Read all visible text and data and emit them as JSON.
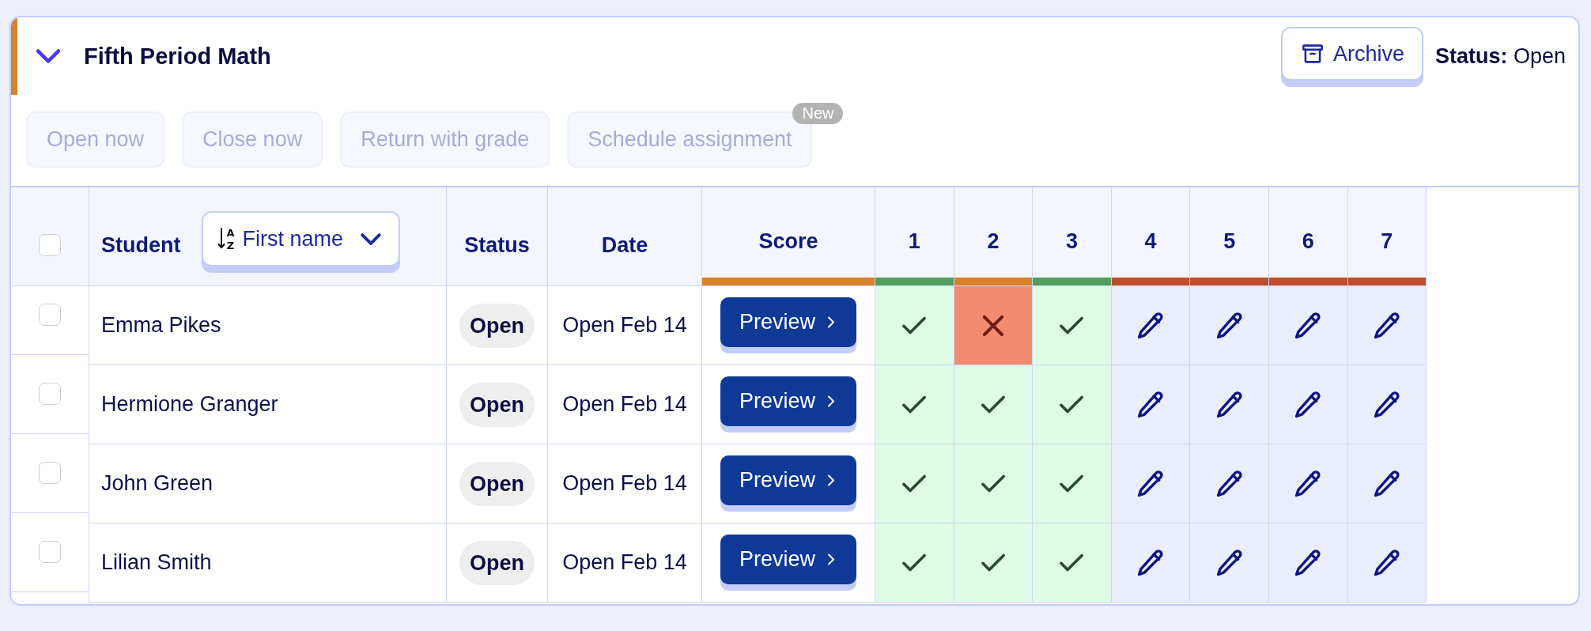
{
  "section": {
    "title": "Fifth Period Math",
    "expanded": true
  },
  "archive_button": {
    "label": "Archive"
  },
  "status": "**Status:** Open",
  "actions": [
    {
      "label": "Open now",
      "disabled": true
    },
    {
      "label": "Close now",
      "disabled": true
    },
    {
      "label": "Return with grade",
      "disabled": true
    },
    {
      "label": "Schedule assignment",
      "disabled": true,
      "badge": "New"
    }
  ],
  "table": {
    "select_all": {
      "checked": false
    },
    "sort": {
      "icon_letters": [
        "A",
        "Z"
      ],
      "label": "First name"
    },
    "columns": [
      {
        "kind": "student",
        "label": "Student"
      },
      {
        "kind": "status",
        "label": "Status"
      },
      {
        "kind": "date",
        "label": "Date"
      },
      {
        "kind": "score",
        "label": "Score",
        "color": "#d9822b"
      },
      {
        "kind": "question",
        "label": "1",
        "color": "#519f5c"
      },
      {
        "kind": "question",
        "label": "2",
        "color": "#d9822b"
      },
      {
        "kind": "question",
        "label": "3",
        "color": "#519f5c"
      },
      {
        "kind": "question",
        "label": "4",
        "color": "#c24b2b"
      },
      {
        "kind": "question",
        "label": "5",
        "color": "#c24b2b"
      },
      {
        "kind": "question",
        "label": "6",
        "color": "#c24b2b"
      },
      {
        "kind": "question",
        "label": "7",
        "color": "#c24b2b"
      }
    ],
    "rows": [
      {
        "checked": false,
        "student": "Emma Pikes",
        "status": "Open",
        "date": "Open Feb 14",
        "action": "Preview",
        "answers": [
          {
            "kind": "correct"
          },
          {
            "kind": "incorrect"
          },
          {
            "kind": "correct"
          },
          {
            "kind": "ungraded"
          },
          {
            "kind": "ungraded"
          },
          {
            "kind": "ungraded"
          },
          {
            "kind": "ungraded"
          }
        ]
      },
      {
        "checked": false,
        "student": "Hermione Granger",
        "status": "Open",
        "date": "Open Feb 14",
        "action": "Preview",
        "answers": [
          {
            "kind": "correct"
          },
          {
            "kind": "correct"
          },
          {
            "kind": "correct"
          },
          {
            "kind": "ungraded"
          },
          {
            "kind": "ungraded"
          },
          {
            "kind": "ungraded"
          },
          {
            "kind": "ungraded"
          }
        ]
      },
      {
        "checked": false,
        "student": "John Green",
        "status": "Open",
        "date": "Open Feb 14",
        "action": "Preview",
        "answers": [
          {
            "kind": "correct"
          },
          {
            "kind": "correct"
          },
          {
            "kind": "correct"
          },
          {
            "kind": "ungraded"
          },
          {
            "kind": "ungraded"
          },
          {
            "kind": "ungraded"
          },
          {
            "kind": "ungraded"
          }
        ]
      },
      {
        "checked": false,
        "student": "Lilian Smith",
        "status": "Open",
        "date": "Open Feb 14",
        "action": "Preview",
        "answers": [
          {
            "kind": "correct"
          },
          {
            "kind": "correct"
          },
          {
            "kind": "correct"
          },
          {
            "kind": "ungraded"
          },
          {
            "kind": "ungraded"
          },
          {
            "kind": "ungraded"
          },
          {
            "kind": "ungraded"
          }
        ]
      }
    ]
  }
}
